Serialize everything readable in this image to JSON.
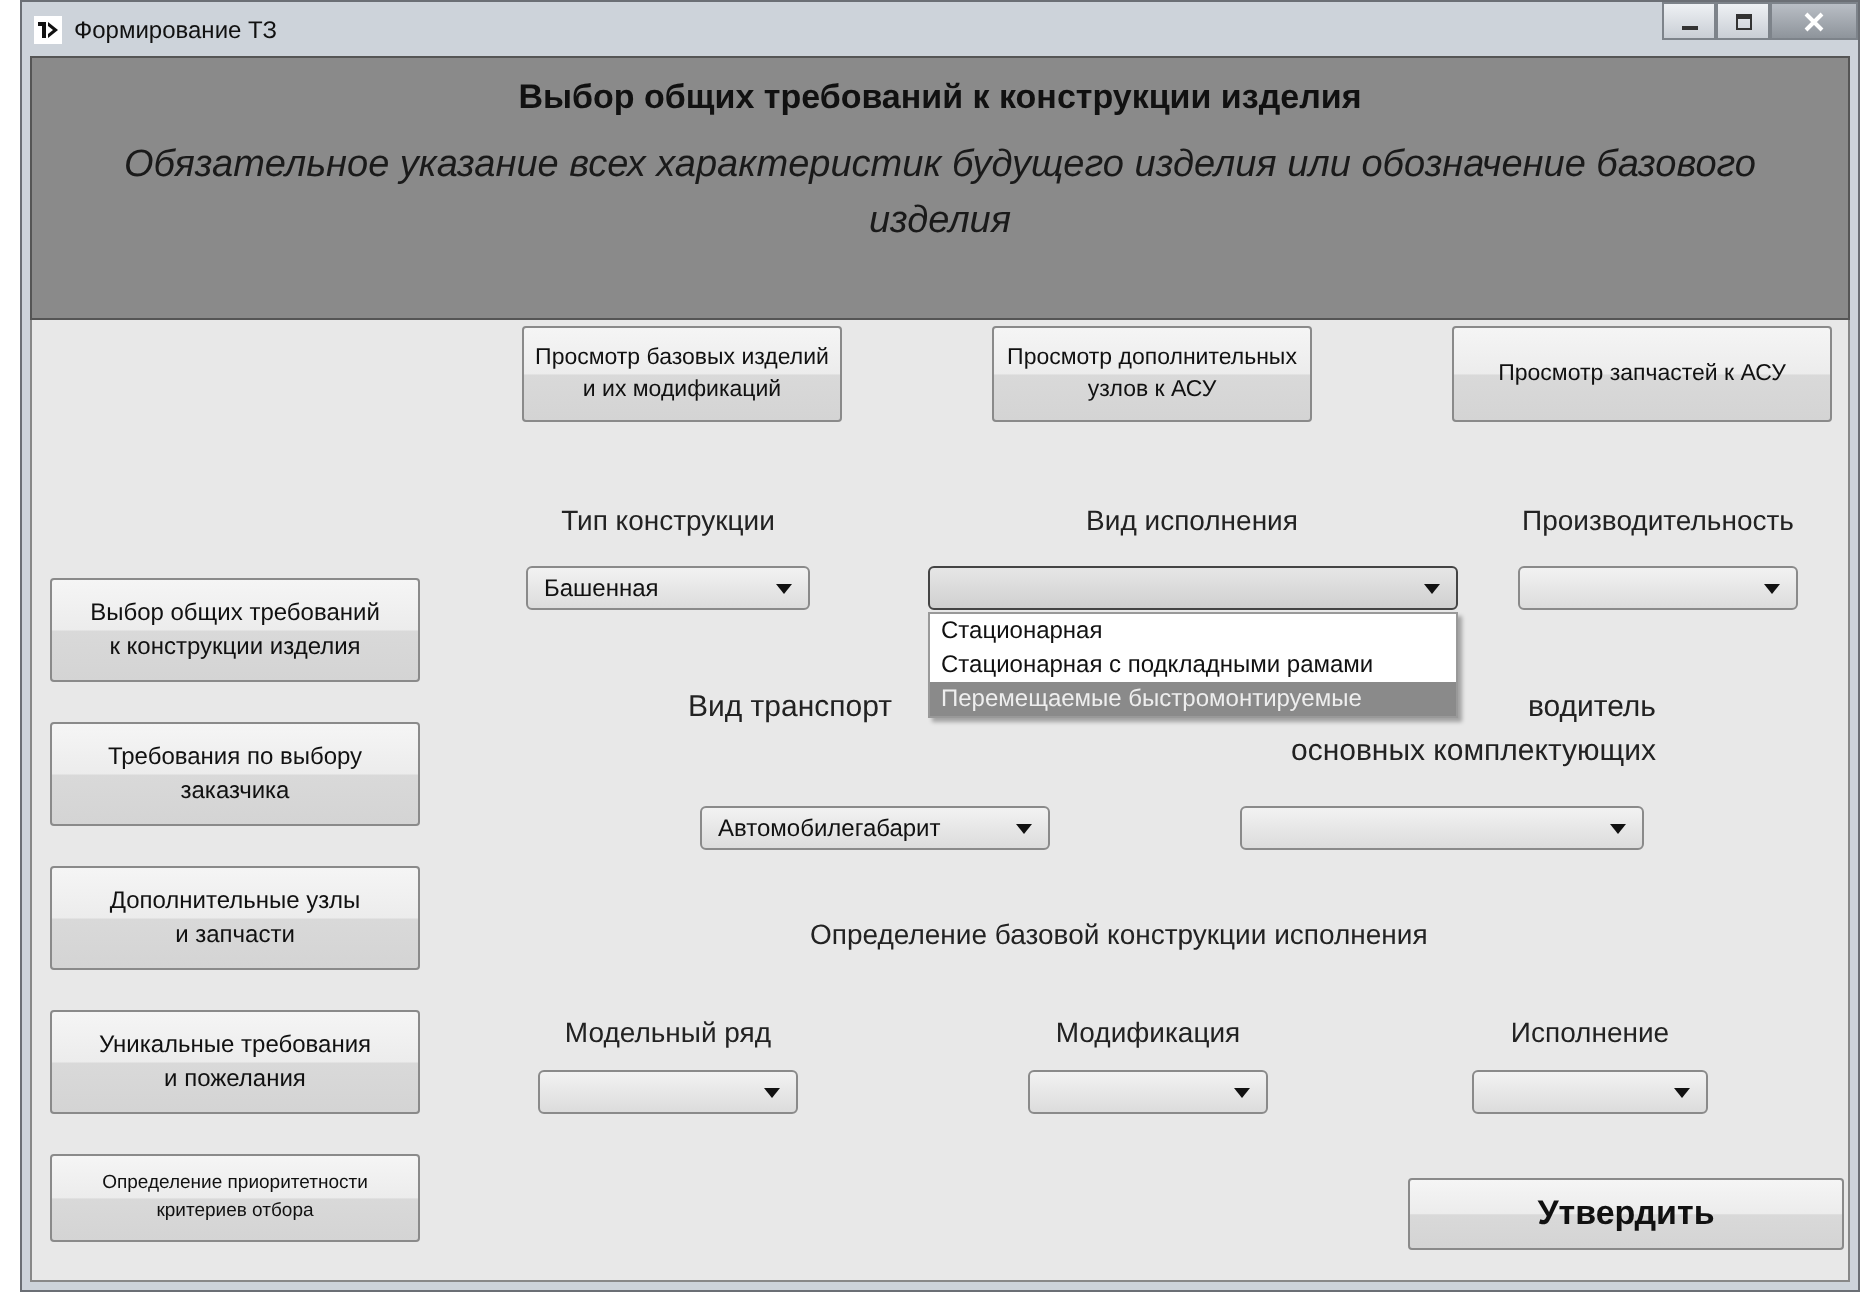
{
  "window": {
    "title": "Формирование ТЗ"
  },
  "header": {
    "title": "Выбор общих требований к конструкции изделия",
    "subtitle": "Обязательное указание всех характеристик будущего изделия или обозначение базового изделия"
  },
  "nav_buttons": [
    {
      "label": "Выбор общих требований\nк конструкции изделия",
      "kind": "regular"
    },
    {
      "label": "Требования по выбору\nзаказчика",
      "kind": "regular"
    },
    {
      "label": "Дополнительные узлы\nи запчасти",
      "kind": "regular"
    },
    {
      "label": "Уникальные требования\nи пожелания",
      "kind": "regular"
    },
    {
      "label": "Определение приоритетности\nкритериев отбора",
      "kind": "compact"
    }
  ],
  "view_buttons": [
    {
      "label": "Просмотр базовых изделий\nи их модификаций"
    },
    {
      "label": "Просмотр дополнительных\nузлов к АСУ"
    },
    {
      "label": "Просмотр запчастей к АСУ"
    }
  ],
  "construction_fields": [
    {
      "label": "Тип конструкции",
      "value": "Башенная",
      "expanded": false
    },
    {
      "label": "Вид исполнения",
      "expanded": true,
      "options": [
        {
          "label": "Стационарная",
          "selected": false
        },
        {
          "label": "Стационарная с подкладными рамами",
          "selected": false
        },
        {
          "label": "Перемещаемые быстромонтируемые",
          "selected": true
        }
      ]
    },
    {
      "label": "Производительность",
      "expanded": false
    }
  ],
  "transport_fields": [
    {
      "label": "Вид транспорт",
      "value": "Автомобилегабарит",
      "expanded": false
    },
    {
      "label": "водитель\nосновных комплектующих",
      "expanded": false
    }
  ],
  "base_section": {
    "title": "Определение базовой конструкции исполнения",
    "fields": [
      {
        "label": "Модельный ряд",
        "expanded": false
      },
      {
        "label": "Модификация",
        "expanded": false
      },
      {
        "label": "Исполнение",
        "expanded": false
      }
    ]
  },
  "submit_button": {
    "label": "Утвердить"
  }
}
